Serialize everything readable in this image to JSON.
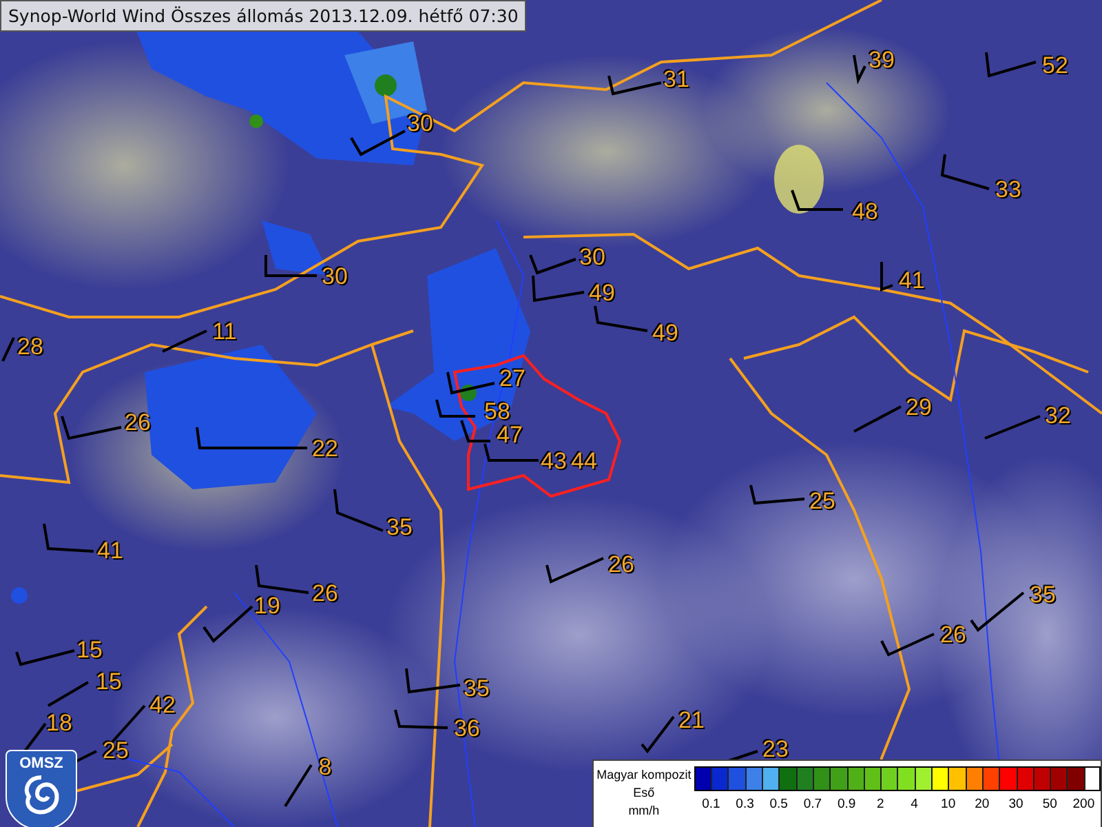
{
  "title": "Synop-World Wind Összes állomás 2013.12.09. hétfő 07:30",
  "stations": [
    {
      "value": "31"
    },
    {
      "value": "39"
    },
    {
      "value": "52"
    },
    {
      "value": "30"
    },
    {
      "value": "33"
    },
    {
      "value": "48"
    },
    {
      "value": "30"
    },
    {
      "value": "30"
    },
    {
      "value": "49"
    },
    {
      "value": "41"
    },
    {
      "value": "11"
    },
    {
      "value": "49"
    },
    {
      "value": "28"
    },
    {
      "value": "27"
    },
    {
      "value": "58"
    },
    {
      "value": "29"
    },
    {
      "value": "26"
    },
    {
      "value": "32"
    },
    {
      "value": "47"
    },
    {
      "value": "22"
    },
    {
      "value": "43"
    },
    {
      "value": "44"
    },
    {
      "value": "25"
    },
    {
      "value": "35"
    },
    {
      "value": "41"
    },
    {
      "value": "26"
    },
    {
      "value": "26"
    },
    {
      "value": "19"
    },
    {
      "value": "35"
    },
    {
      "value": "26"
    },
    {
      "value": "15"
    },
    {
      "value": "15"
    },
    {
      "value": "35"
    },
    {
      "value": "42"
    },
    {
      "value": "18"
    },
    {
      "value": "21"
    },
    {
      "value": "36"
    },
    {
      "value": "25"
    },
    {
      "value": "23"
    },
    {
      "value": "8"
    }
  ],
  "logo": {
    "text": "OMSZ"
  },
  "legend": {
    "title": "Magyar kompozit",
    "subtitle": "Eső",
    "unit": "mm/h",
    "bins": [
      {
        "color": "#0000b0"
      },
      {
        "color": "#0a28d0"
      },
      {
        "color": "#2050e0"
      },
      {
        "color": "#3c80e8"
      },
      {
        "color": "#50b0f0"
      },
      {
        "color": "#107010"
      },
      {
        "color": "#208020"
      },
      {
        "color": "#309018"
      },
      {
        "color": "#40a018"
      },
      {
        "color": "#50b018"
      },
      {
        "color": "#60c018"
      },
      {
        "color": "#70d020"
      },
      {
        "color": "#80e020"
      },
      {
        "color": "#a0f030"
      },
      {
        "color": "#ffff00"
      },
      {
        "color": "#ffc000"
      },
      {
        "color": "#ff8000"
      },
      {
        "color": "#ff4000"
      },
      {
        "color": "#ff0000"
      },
      {
        "color": "#e00000"
      },
      {
        "color": "#c00000"
      },
      {
        "color": "#a00000"
      },
      {
        "color": "#800000"
      }
    ],
    "ticks": [
      "0.1",
      "0.3",
      "0.5",
      "0.7",
      "0.9",
      "2",
      "4",
      "10",
      "20",
      "30",
      "50",
      "200"
    ]
  }
}
